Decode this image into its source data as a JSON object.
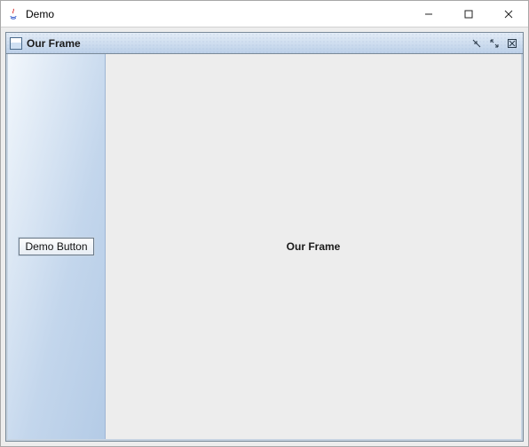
{
  "window": {
    "title": "Demo"
  },
  "internalFrame": {
    "title": "Our Frame",
    "button_label": "Demo Button",
    "center_label": "Our Frame"
  }
}
